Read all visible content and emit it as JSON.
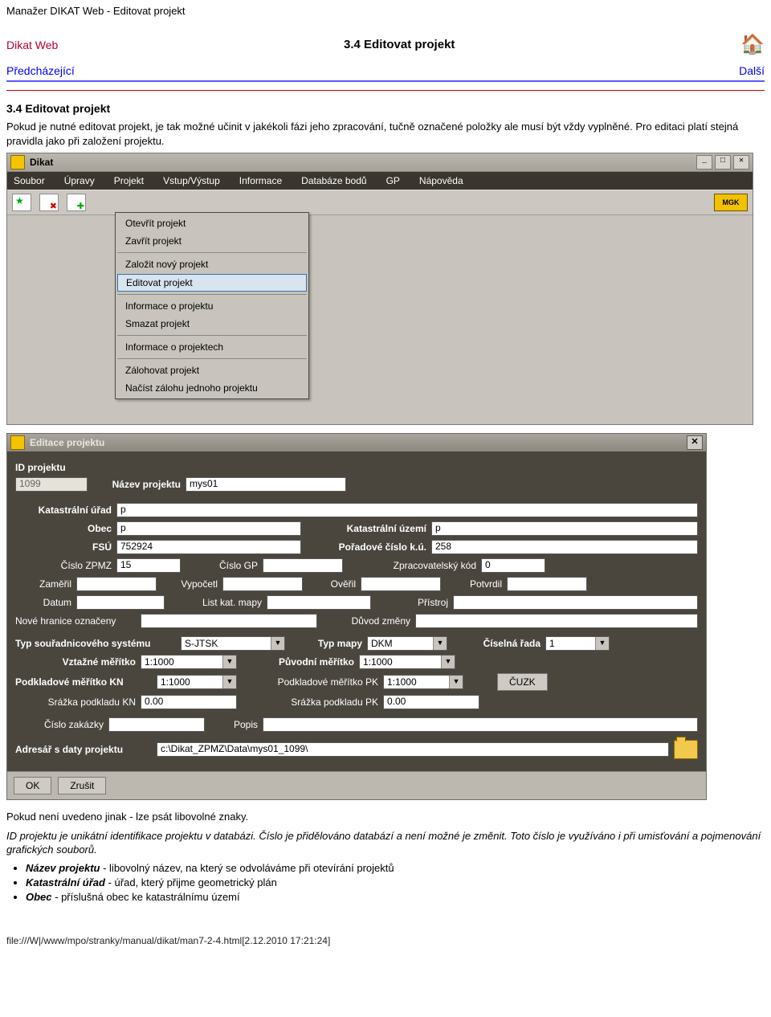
{
  "doc_title": "Manažer DIKAT Web - Editovat projekt",
  "header": {
    "left": "Dikat Web",
    "center": "3.4 Editovat projekt"
  },
  "nav": {
    "prev": "Předcházející",
    "next": "Další"
  },
  "section_title": "3.4 Editovat projekt",
  "intro": "Pokud je nutné editovat projekt, je tak možné učinit v jakékoli fázi jeho zpracování, tučně označené položky ale musí být vždy vyplněné. Pro editaci platí stejná pravidla jako při založení projektu.",
  "main_window": {
    "title": "Dikat",
    "logo_text": "MGK",
    "menu": [
      "Soubor",
      "Úpravy",
      "Projekt",
      "Vstup/Výstup",
      "Informace",
      "Databáze bodů",
      "GP",
      "Nápověda"
    ],
    "projekt_submenu": [
      "Otevřít projekt",
      "Zavřít projekt",
      "__sep__",
      "Založit nový projekt",
      "Editovat projekt",
      "__sep__",
      "Informace o projektu",
      "Smazat projekt",
      "__sep__",
      "Informace o projektech",
      "__sep__",
      "Zálohovat projekt",
      "Načíst zálohu jednoho projektu"
    ],
    "highlight_index": 4
  },
  "dialog": {
    "title": "Editace projektu",
    "labels": {
      "id": "ID projektu",
      "name": "Název projektu",
      "kat_urad": "Katastrální úřad",
      "obec": "Obec",
      "kat_uzemi": "Katastrální území",
      "fsu": "FSÚ",
      "porad_cislo": "Pořadové číslo k.ú.",
      "zpmz": "Číslo ZPMZ",
      "cgp": "Číslo GP",
      "zprac_kod": "Zpracovatelský kód",
      "zameril": "Zaměřil",
      "vypocetl": "Vypočetl",
      "overil": "Ověřil",
      "potvrdil": "Potvrdil",
      "datum": "Datum",
      "list": "List kat. mapy",
      "pristroj": "Přístroj",
      "nove_hranice": "Nové hranice označeny",
      "duvod": "Důvod změny",
      "souradnice": "Typ souřadnicového systému",
      "typ_mapy": "Typ mapy",
      "cis_rada": "Číselná řada",
      "vztazne": "Vztažné měřítko",
      "puvodni": "Původní měřítko",
      "podkl_kn": "Podkladové měřítko KN",
      "podkl_pk": "Podkladové měřítko PK",
      "srazka_kn": "Srážka podkladu KN",
      "srazka_pk": "Srážka podkladu PK",
      "zakazka": "Číslo zakázky",
      "popis": "Popis",
      "adresar": "Adresář s daty projektu",
      "cuzk": "ČUZK"
    },
    "values": {
      "id": "1099",
      "name": "mys01",
      "kat_urad": "p",
      "obec": "p",
      "kat_uzemi": "p",
      "fsu": "752924",
      "porad_cislo": "258",
      "zpmz": "15",
      "cgp": "",
      "zprac_kod": "0",
      "zameril": "",
      "vypocetl": "",
      "overil": "",
      "potvrdil": "",
      "datum": "",
      "list": "",
      "pristroj": "",
      "nove_hranice": "",
      "duvod": "",
      "souradnice": "S-JTSK",
      "typ_mapy": "DKM",
      "cis_rada": "1",
      "vztazne": "1:1000",
      "puvodni": "1:1000",
      "podkl_kn": "1:1000",
      "podkl_pk": "1:1000",
      "srazka_kn": "0.00",
      "srazka_pk": "0.00",
      "zakazka": "",
      "popis": "",
      "adresar": "c:\\Dikat_ZPMZ\\Data\\mys01_1099\\"
    },
    "buttons": {
      "ok": "OK",
      "cancel": "Zrušit"
    }
  },
  "after_dialog": {
    "line1": "Pokud není uvedeno jinak - lze psát libovolné znaky.",
    "line2": "ID projektu je unikátní identifikace projektu v databázi. Číslo je přidělováno databází a není možné je změnit. Toto číslo je využíváno i při umisťování a pojmenování grafických souborů."
  },
  "bullets": [
    {
      "b": "Název projektu",
      "t": " - libovolný název, na který se odvoláváme při otevírání projektů"
    },
    {
      "b": "Katastrální úřad",
      "t": " - úřad, který přijme geometrický plán"
    },
    {
      "b": "Obec",
      "t": " - příslušná obec ke katastrálnímu území"
    }
  ],
  "footer": "file:///W|/www/mpo/stranky/manual/dikat/man7-2-4.html[2.12.2010 17:21:24]"
}
